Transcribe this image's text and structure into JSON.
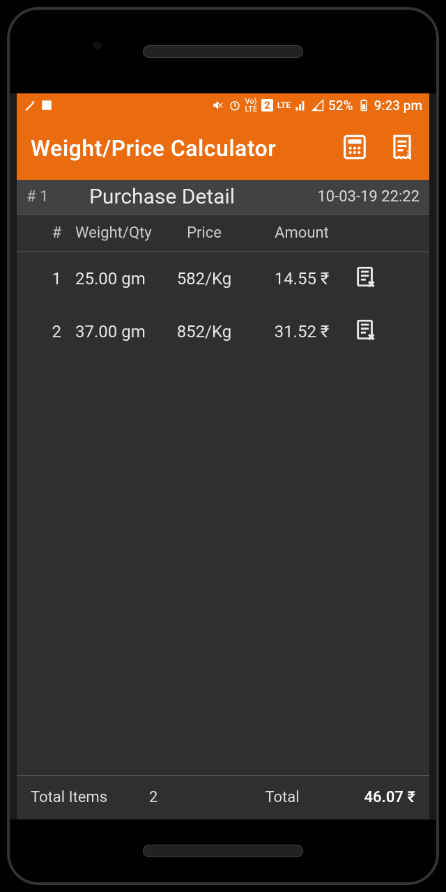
{
  "status_bar": {
    "battery_pct": "52%",
    "time": "9:23 pm",
    "sim": "2",
    "net": "LTE"
  },
  "app_bar": {
    "title": "Weight/Price Calculator"
  },
  "subheader": {
    "number": "# 1",
    "title": "Purchase Detail",
    "datetime": "10-03-19 22:22"
  },
  "columns": {
    "idx": "#",
    "weight": "Weight/Qty",
    "price": "Price",
    "amount": "Amount"
  },
  "rows": [
    {
      "idx": "1",
      "weight": "25.00 gm",
      "price": "582/Kg",
      "amount": "14.55 ₹"
    },
    {
      "idx": "2",
      "weight": "37.00 gm",
      "price": "852/Kg",
      "amount": "31.52 ₹"
    }
  ],
  "footer": {
    "items_label": "Total Items",
    "items_count": "2",
    "total_label": "Total",
    "total_value": "46.07 ₹"
  }
}
